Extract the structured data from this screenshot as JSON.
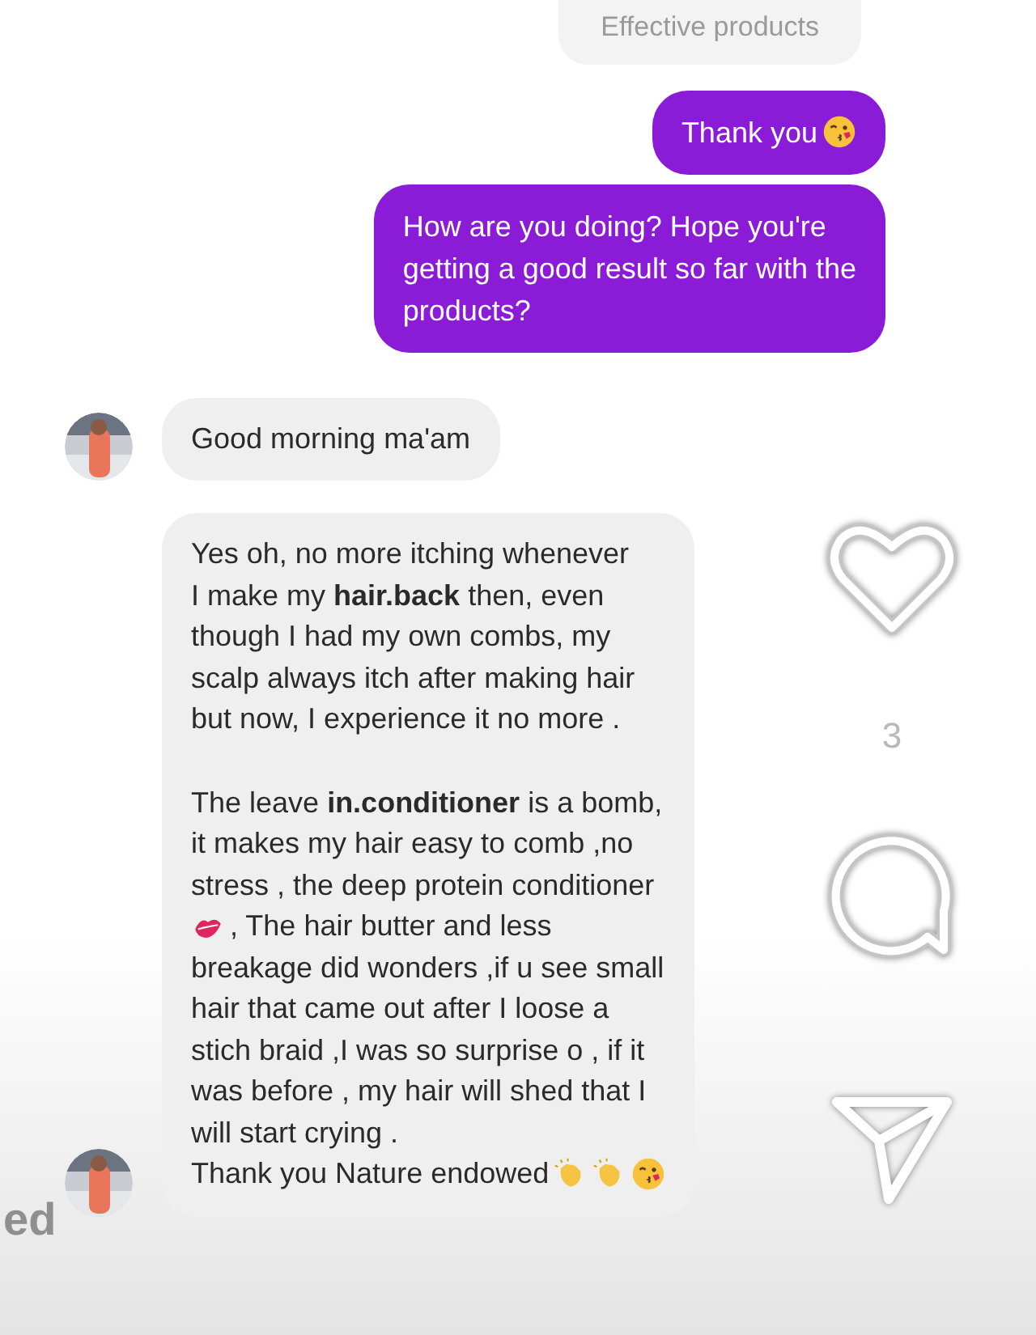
{
  "quoted_message": {
    "text": "Effective products"
  },
  "messages": [
    {
      "kind": "sent",
      "lines": [
        {
          "parts": [
            {
              "kind": "text",
              "text": "Thank you"
            },
            {
              "kind": "kiss_face"
            }
          ]
        }
      ]
    },
    {
      "kind": "sent",
      "lines": [
        {
          "parts": [
            {
              "kind": "text",
              "text": "How are you doing? Hope you're"
            }
          ]
        },
        {
          "parts": [
            {
              "kind": "text",
              "text": "getting a good result so far with the"
            }
          ]
        },
        {
          "parts": [
            {
              "kind": "text",
              "text": "products?"
            }
          ]
        }
      ]
    },
    {
      "kind": "received",
      "lines": [
        {
          "parts": [
            {
              "kind": "text",
              "text": "Good morning ma'am"
            }
          ]
        }
      ]
    },
    {
      "kind": "received",
      "lines": [
        {
          "parts": [
            {
              "kind": "text",
              "text": "Yes oh, no more itching whenever"
            }
          ]
        },
        {
          "parts": [
            {
              "kind": "text",
              "text": "I make my **hair.back** then, even"
            }
          ]
        },
        {
          "parts": [
            {
              "kind": "text",
              "text": "though I had my own combs, my"
            }
          ]
        },
        {
          "parts": [
            {
              "kind": "text",
              "text": "scalp always itch after making hair"
            }
          ]
        },
        {
          "parts": [
            {
              "kind": "text",
              "text": "but now, I experience it no more ."
            }
          ]
        },
        {
          "kind": "blank"
        },
        {
          "parts": [
            {
              "kind": "text",
              "text": "The leave **in.conditioner** is a bomb,"
            }
          ]
        },
        {
          "parts": [
            {
              "kind": "text",
              "text": "it makes my hair easy to comb ,no"
            }
          ]
        },
        {
          "parts": [
            {
              "kind": "text",
              "text": "stress , the deep protein conditioner"
            }
          ]
        },
        {
          "parts": [
            {
              "kind": "lips"
            },
            {
              "kind": "text",
              "text": ", The hair butter and less"
            }
          ]
        },
        {
          "parts": [
            {
              "kind": "text",
              "text": "breakage did wonders ,if u see small"
            }
          ]
        },
        {
          "parts": [
            {
              "kind": "text",
              "text": "hair that came out after I loose a"
            }
          ]
        },
        {
          "parts": [
            {
              "kind": "text",
              "text": "stich braid ,I was so surprise o , if it"
            }
          ]
        },
        {
          "parts": [
            {
              "kind": "text",
              "text": "was before , my hair will shed that I"
            }
          ]
        },
        {
          "parts": [
            {
              "kind": "text",
              "text": "will start crying ."
            }
          ]
        },
        {
          "parts": [
            {
              "kind": "text",
              "text": "Thank you Nature endowed"
            },
            {
              "kind": "clap"
            },
            {
              "kind": "clap"
            },
            {
              "kind": "kiss_face"
            }
          ]
        }
      ]
    }
  ],
  "reel_actions": {
    "like_count": "3"
  },
  "side_caption": "ed"
}
